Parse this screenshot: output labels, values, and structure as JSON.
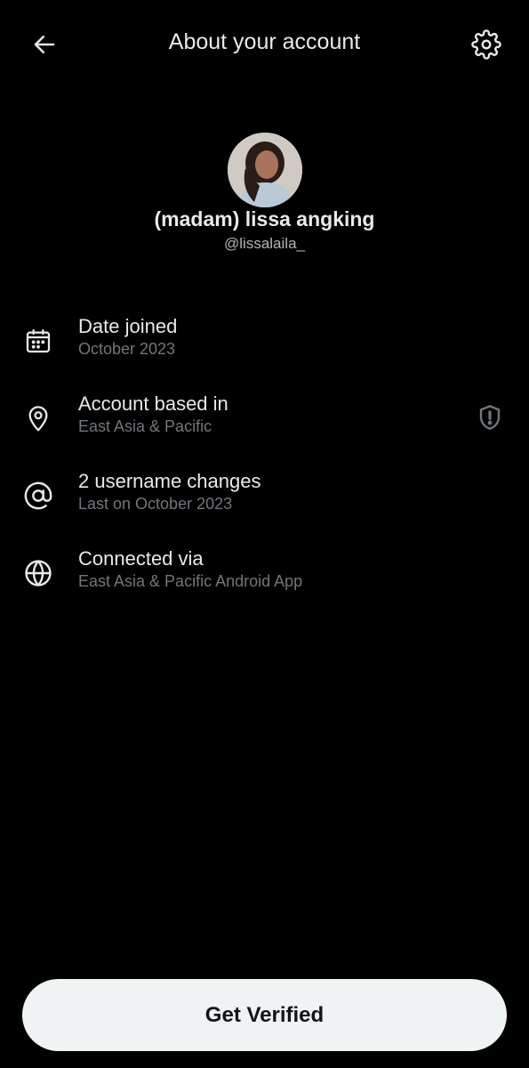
{
  "header": {
    "title": "About your account",
    "back_icon": "arrow-left-icon",
    "settings_icon": "gear-icon"
  },
  "profile": {
    "display_name": "(madam) lissa angking",
    "handle": "@lissalaila_"
  },
  "info_rows": [
    {
      "icon": "calendar-icon",
      "label": "Date joined",
      "value": "October 2023"
    },
    {
      "icon": "location-pin-icon",
      "label": "Account based in",
      "value": "East Asia & Pacific",
      "badge_icon": "shield-alert-icon"
    },
    {
      "icon": "at-sign-icon",
      "label": "2 username changes",
      "value": "Last on October 2023"
    },
    {
      "icon": "globe-icon",
      "label": "Connected via",
      "value": "East Asia & Pacific Android App"
    }
  ],
  "footer": {
    "verify_label": "Get Verified"
  },
  "colors": {
    "background": "#000000",
    "primary_text": "#e7e9ea",
    "secondary_text": "#71767b",
    "button_bg": "#eff3f4",
    "button_text": "#0f1419"
  }
}
